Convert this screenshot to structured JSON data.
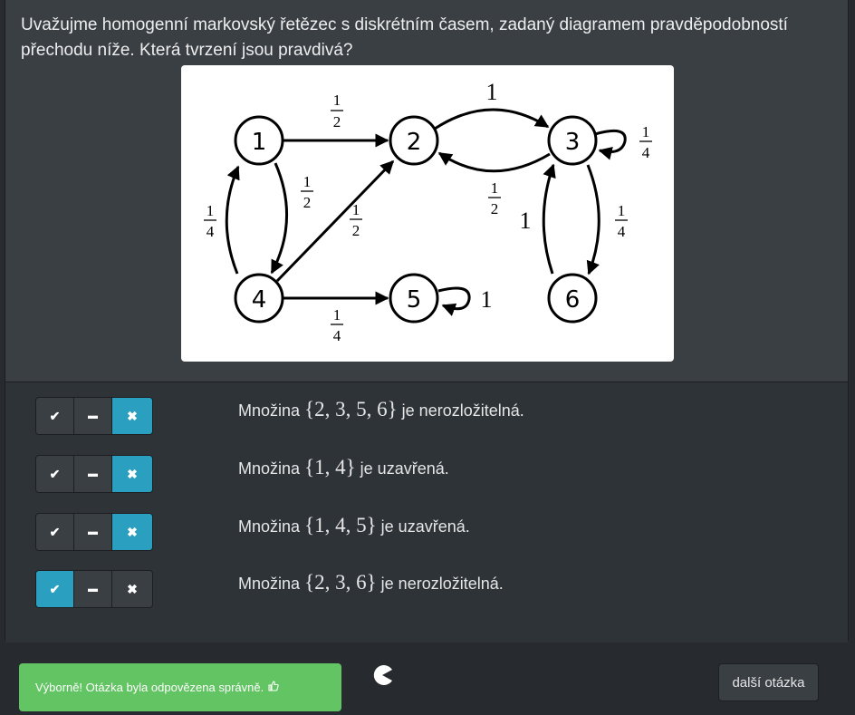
{
  "question": "Uvažujme homogenní markovský řetězec s diskrétním časem, zadaný diagramem pravděpodobností přechodu níže. Která tvrzení jsou pravdivá?",
  "diagram": {
    "nodes": [
      "1",
      "2",
      "3",
      "4",
      "5",
      "6"
    ],
    "edge_labels": {
      "e12": {
        "num": "1",
        "den": "2"
      },
      "e23": "1",
      "e32": {
        "num": "1",
        "den": "2"
      },
      "e33": {
        "num": "1",
        "den": "4"
      },
      "e14": {
        "num": "1",
        "den": "2"
      },
      "e41": {
        "num": "1",
        "den": "4"
      },
      "e42": {
        "num": "1",
        "den": "2"
      },
      "e45": {
        "num": "1",
        "den": "4"
      },
      "e55": "1",
      "e63": "1",
      "e36": {
        "num": "1",
        "den": "4"
      }
    }
  },
  "buttons": {
    "yes": "✔",
    "neutral": "▬",
    "no": "✖"
  },
  "statements": [
    {
      "prefix": "Množina",
      "math": "{2, 3, 5, 6}",
      "suffix": "je nerozložitelná.",
      "selected": "no"
    },
    {
      "prefix": "Množina",
      "math": "{1, 4}",
      "suffix": "je uzavřená.",
      "selected": "no"
    },
    {
      "prefix": "Množina",
      "math": "{1, 4, 5}",
      "suffix": "je uzavřená.",
      "selected": "no"
    },
    {
      "prefix": "Množina",
      "math": "{2, 3, 6}",
      "suffix": "je nerozložitelná.",
      "selected": "yes"
    }
  ],
  "feedback": {
    "text": "Výborně! Otázka byla odpovězena správně.",
    "icon": "thumbs-up-icon"
  },
  "next_button": "další otázka",
  "colors": {
    "active": "#2a9fc0",
    "success": "#62c462",
    "panel": "#3a3f44",
    "background": "#272b30"
  }
}
